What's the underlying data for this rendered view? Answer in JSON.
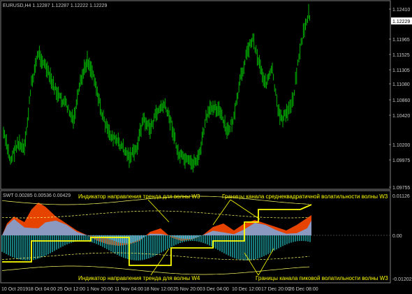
{
  "colors": {
    "background": "#000000",
    "candle": "#00b400",
    "axis_text": "#c8c8c8",
    "annotation": "#ffff00",
    "grid": "#2a2a2a",
    "osc_orange": "#ff4a00",
    "osc_blue": "#7aa7e0",
    "osc_teal": "#1f9a9a",
    "price_tag_bg": "#ffffff"
  },
  "main": {
    "symbol_label": "EURUSD,H4  1.12287 1.12287 1.12222 1.12229",
    "current_price": "1.12229",
    "y_labels": [
      "1.12410",
      "1.11965",
      "1.11525",
      "1.11305",
      "1.11080",
      "1.10860",
      "1.10420",
      "1.10200",
      "1.09975",
      "1.09755"
    ]
  },
  "sub": {
    "indicator_label": "SWT 0.00285 0.00536 0.00429",
    "y_labels": [
      "0.01126",
      "0.00",
      "-0.01202"
    ]
  },
  "annotations": {
    "trend_w3": "Индикатор направления тренда для волны W3",
    "channel_rms": "Границы канала среднеквадратичной волатильности волны W3",
    "trend_w4": "Индикатор направления тренда для волны W4",
    "channel_peak": "Границы канала пиковой волатильности волны W3"
  },
  "x_labels": [
    "10 Oct 2019",
    "18 Oct 04:00",
    "25 Oct 12:00",
    "1 Nov 20:00",
    "11 Nov 04:00",
    "18 Nov 12:00",
    "25 Nov 20:00",
    "3 Dec 04:00",
    "10 Dec 12:00",
    "17 Dec 20:00",
    "26 Dec 08:00"
  ]
}
